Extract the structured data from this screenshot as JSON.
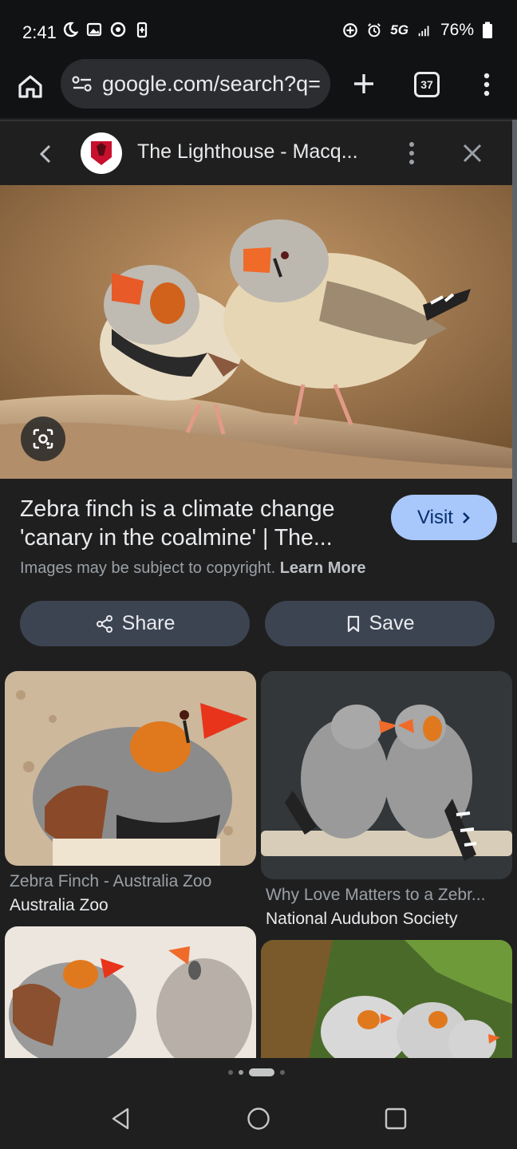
{
  "status_bar": {
    "time": "2:41",
    "network": "5G",
    "battery": "76%"
  },
  "toolbar": {
    "url": "google.com/search?q=",
    "tab_count": "37"
  },
  "viewer": {
    "site_title": "The Lighthouse - Macq..."
  },
  "result": {
    "title": "Zebra finch is a climate change 'canary in the coalmine' | The...",
    "visit_label": "Visit",
    "copyright_text": "Images may be subject to copyright.",
    "learn_more": "Learn More",
    "share_label": "Share",
    "save_label": "Save"
  },
  "related": [
    {
      "title": "Zebra Finch - Australia Zoo",
      "source": "Australia Zoo"
    },
    {
      "title": "Why Love Matters to a Zebr...",
      "source": "National Audubon Society"
    }
  ],
  "colors": {
    "visit_bg": "#a8c7fa",
    "action_bg": "#3c4452",
    "background": "#1f1f1f"
  },
  "icons": [
    "home-icon",
    "site-settings-icon",
    "plus-icon",
    "tab-switcher-icon",
    "more-vert-icon",
    "back-arrow-icon",
    "close-icon",
    "lens-icon",
    "share-icon",
    "bookmark-icon",
    "chevron-right-icon"
  ]
}
